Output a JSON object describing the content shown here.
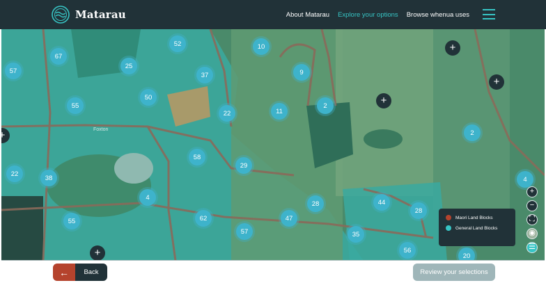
{
  "header": {
    "brand": "Matarau",
    "nav": [
      "About Matarau",
      "Explore your options",
      "Browse whenua uses"
    ]
  },
  "colors": {
    "header_bg": "#213238",
    "accent": "#37c5c5",
    "maori_land": "#b5432d",
    "general_land": "#37c5c5",
    "marker": "#3eb3cb"
  },
  "map": {
    "place_label": "Foxton",
    "clusters": [
      "67",
      "52",
      "10",
      "57",
      "25",
      "37",
      "9",
      "55",
      "50",
      "2",
      "11",
      "22",
      "2",
      "58",
      "29",
      "22",
      "38",
      "4",
      "4",
      "28",
      "44",
      "28",
      "55",
      "62",
      "57",
      "47",
      "35",
      "56",
      "20"
    ],
    "plus_markers": [
      "+",
      "+",
      "+",
      "+",
      "+"
    ],
    "legend": [
      {
        "label": "Maori Land Blocks",
        "icon": "red-dot"
      },
      {
        "label": "General Land Blocks",
        "icon": "teal-dot"
      }
    ],
    "controls": [
      "+",
      "−",
      "⛶",
      "◉",
      "☰"
    ]
  },
  "footer": {
    "back_arrow": "←",
    "back_label": "Back",
    "review_label": "Review your selections"
  }
}
